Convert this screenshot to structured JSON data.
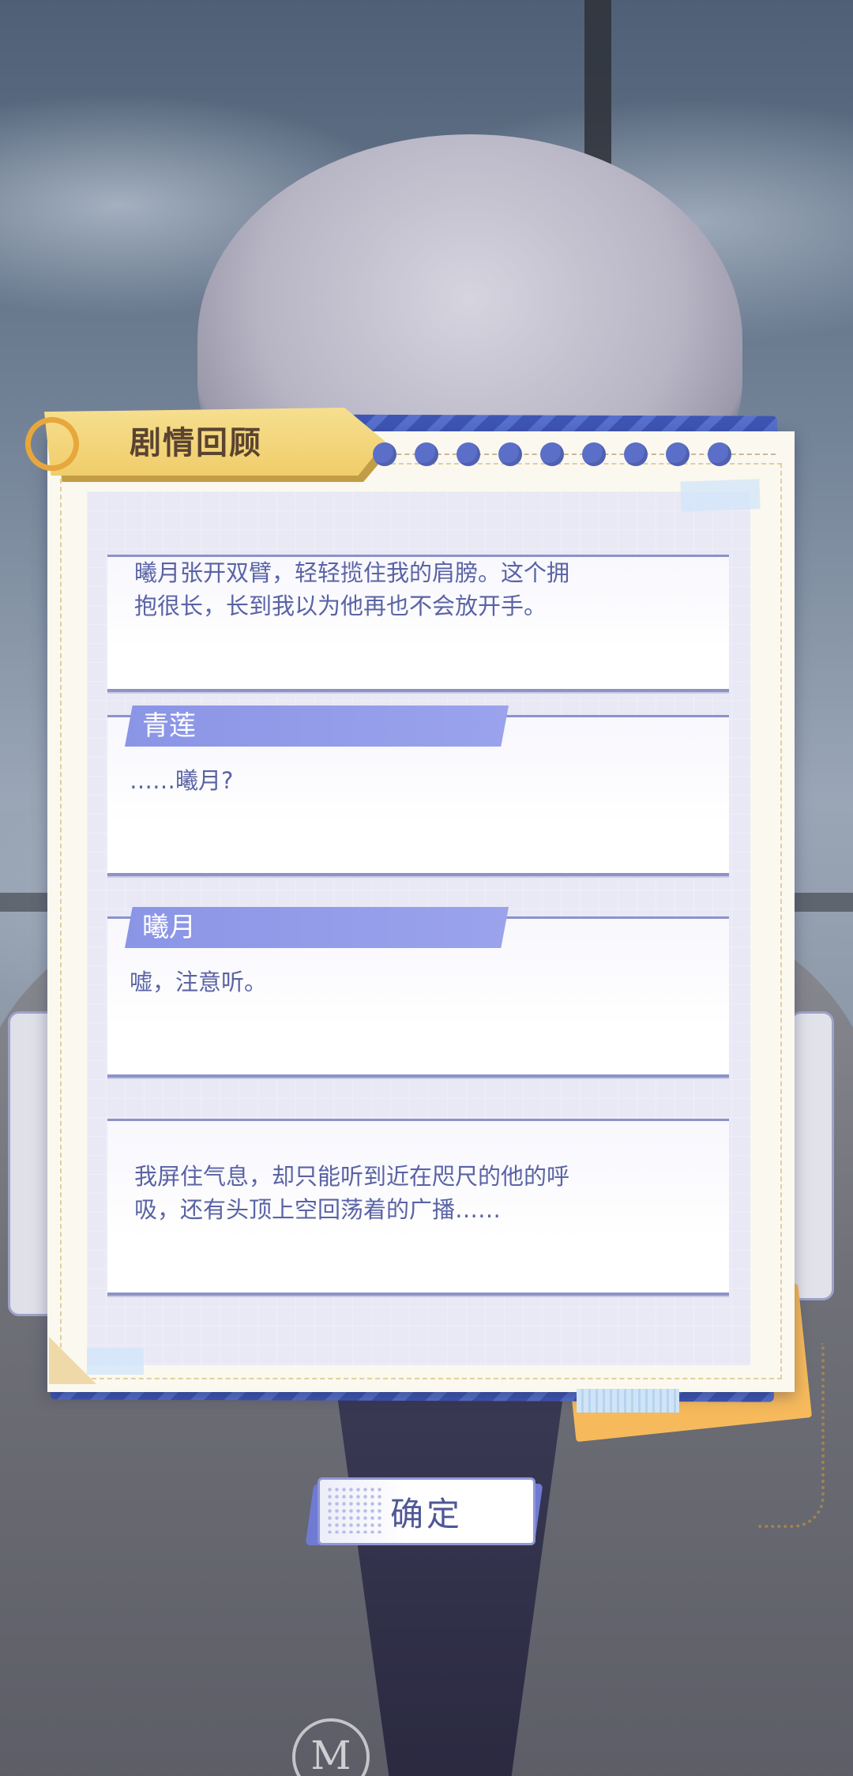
{
  "panel": {
    "title": "剧情回顾",
    "dot_count": 9
  },
  "entries": [
    {
      "speaker": "",
      "text": "曦月张开双臂，轻轻揽住我的肩膀。这个拥\n抱很长，长到我以为他再也不会放开手。"
    },
    {
      "speaker": "青莲",
      "text": "……曦月?"
    },
    {
      "speaker": "曦月",
      "text": "嘘，注意听。"
    },
    {
      "speaker": "",
      "text": "我屏住气息，却只能听到近在咫尺的他的呼\n吸，还有头顶上空回荡着的广播……"
    }
  ],
  "confirm_button": {
    "label": "确定"
  },
  "background": {
    "emblem": "M"
  },
  "colors": {
    "accent": "#5b6fc8",
    "speaker_tab": "#8b95e6",
    "title_banner": "#f0cd6a",
    "text": "#5a63a5"
  }
}
